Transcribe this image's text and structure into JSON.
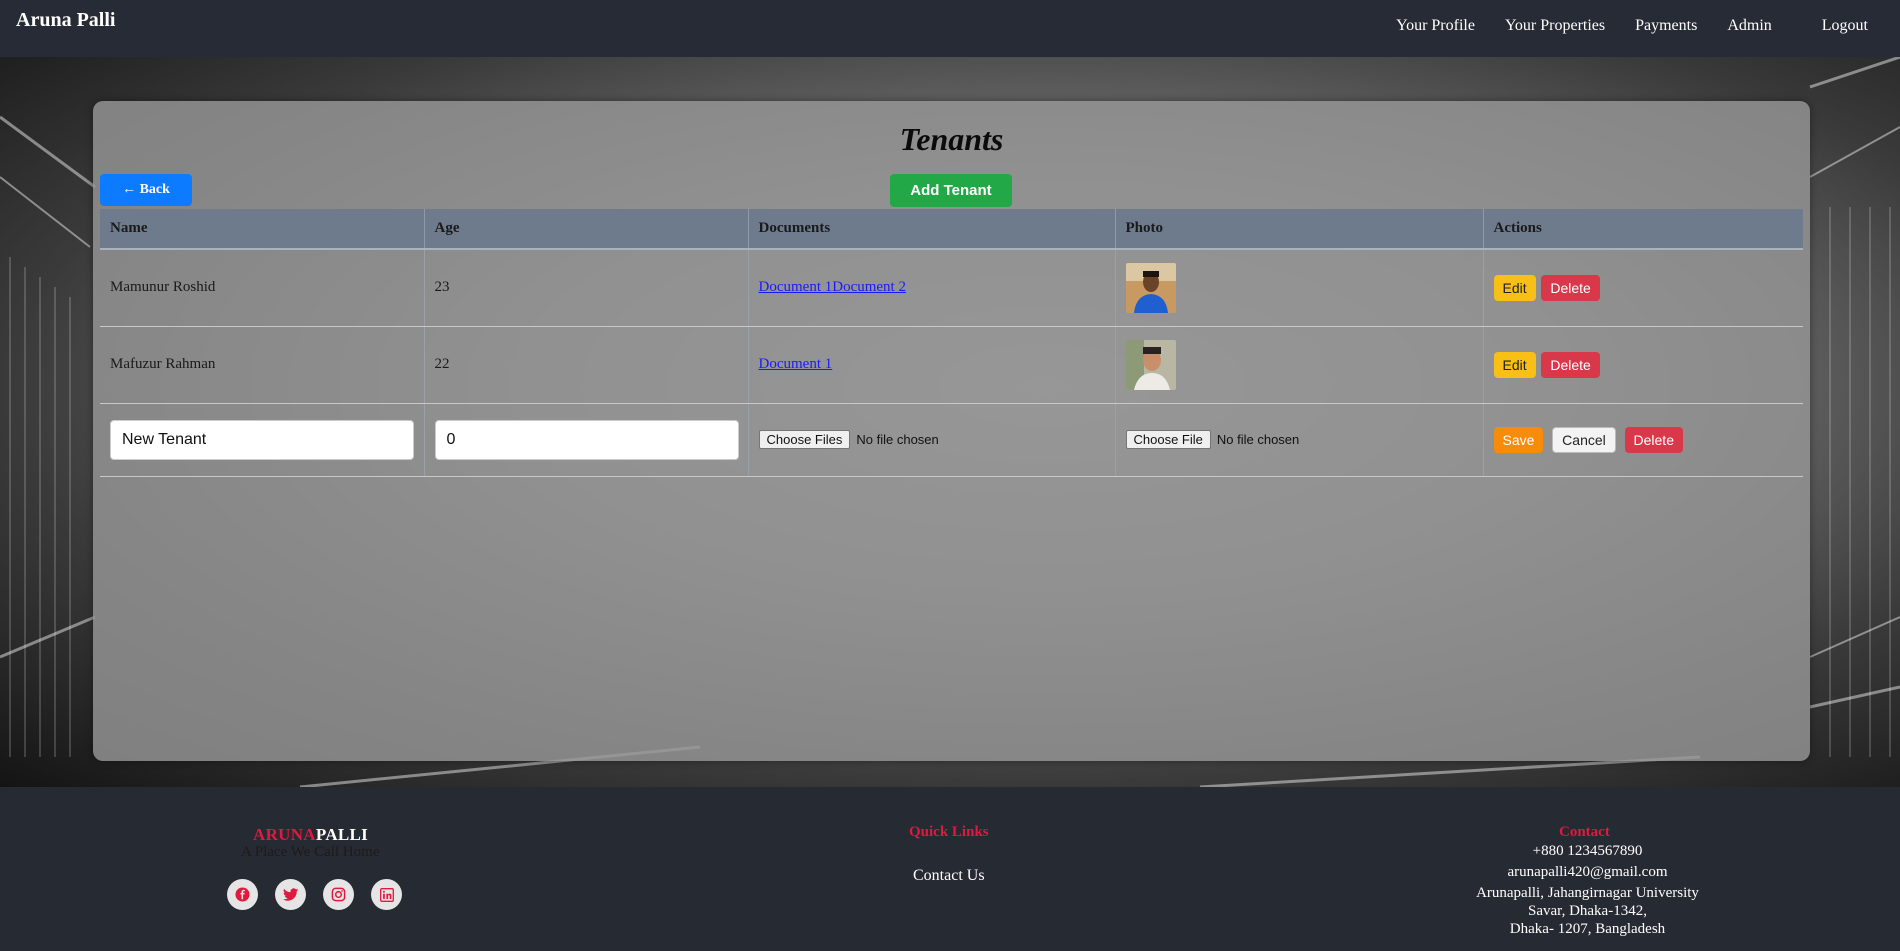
{
  "navbar": {
    "brand": "Aruna Palli",
    "links": [
      "Your Profile",
      "Your Properties",
      "Payments",
      "Admin"
    ],
    "logout": "Logout"
  },
  "page": {
    "title": "Tenants",
    "back_label": "← Back",
    "add_label": "Add Tenant"
  },
  "table": {
    "headers": [
      "Name",
      "Age",
      "Documents",
      "Photo",
      "Actions"
    ],
    "rows": [
      {
        "name": "Mamunur Roshid",
        "age": "23",
        "documents": [
          "Document 1",
          "Document 2"
        ]
      },
      {
        "name": "Mafuzur Rahman",
        "age": "22",
        "documents": [
          "Document 1"
        ]
      }
    ],
    "edit_label": "Edit",
    "delete_label": "Delete",
    "new_row": {
      "name_value": "New Tenant",
      "age_value": "0",
      "docs_button": "Choose Files",
      "photo_button": "Choose File",
      "no_file": "No file chosen",
      "save_label": "Save",
      "cancel_label": "Cancel",
      "delete_label": "Delete"
    }
  },
  "footer": {
    "brand_red": "ARUNA",
    "brand_white": "PALLI",
    "tagline": "A Place We Call Home",
    "socials": [
      "facebook-icon",
      "twitter-icon",
      "instagram-icon",
      "linkedin-icon"
    ],
    "quick_links_title": "Quick Links",
    "contact_us": "Contact Us",
    "contact_title": "Contact",
    "phone": "+880 1234567890",
    "email": "arunapalli420@gmail.com",
    "address1": "Arunapalli, Jahangirnagar University",
    "address2": "Savar, Dhaka-1342,",
    "address3": "Dhaka- 1207, Bangladesh"
  },
  "colors": {
    "accent_red": "#e0193f",
    "back_blue": "#0d7bff",
    "add_green": "#22a846",
    "edit_yellow": "#f8bf17",
    "delete_red": "#d9384a",
    "save_orange": "#f78b0a"
  }
}
